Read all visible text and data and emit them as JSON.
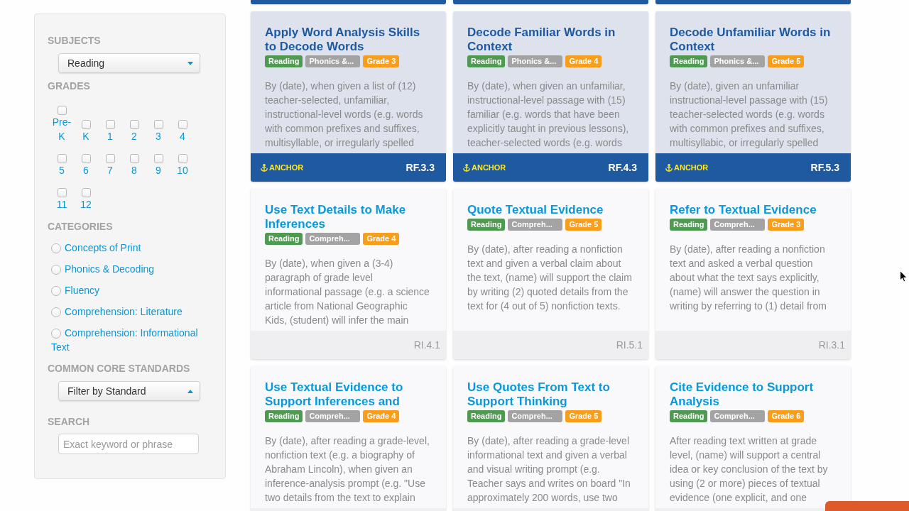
{
  "sidebar": {
    "subjects": {
      "heading": "SUBJECTS",
      "select": {
        "value": "Reading",
        "expanded": false
      }
    },
    "grades": {
      "heading": "GRADES",
      "items": [
        {
          "label": "Pre-K",
          "checked": false
        },
        {
          "label": "K",
          "checked": false
        },
        {
          "label": "1",
          "checked": false
        },
        {
          "label": "2",
          "checked": false
        },
        {
          "label": "3",
          "checked": false
        },
        {
          "label": "4",
          "checked": false
        },
        {
          "label": "5",
          "checked": false
        },
        {
          "label": "6",
          "checked": false
        },
        {
          "label": "7",
          "checked": false
        },
        {
          "label": "8",
          "checked": false
        },
        {
          "label": "9",
          "checked": false
        },
        {
          "label": "10",
          "checked": false
        },
        {
          "label": "11",
          "checked": false
        },
        {
          "label": "12",
          "checked": false
        }
      ]
    },
    "categories": {
      "heading": "CATEGORIES",
      "items": [
        {
          "label": "Concepts of Print",
          "selected": false
        },
        {
          "label": "Phonics & Decoding",
          "selected": false
        },
        {
          "label": "Fluency",
          "selected": false
        },
        {
          "label": "Comprehension: Literature",
          "selected": false
        },
        {
          "label": "Comprehension: Informational Text",
          "selected": false
        }
      ]
    },
    "standards": {
      "heading": "COMMON CORE STANDARDS",
      "select": {
        "value": "Filter by Standard",
        "expanded": true
      }
    },
    "search": {
      "heading": "SEARCH",
      "placeholder": "Exact keyword or phrase"
    }
  },
  "partial_cards": [
    {
      "anchor": true
    },
    {
      "anchor": true
    },
    {
      "anchor": true
    }
  ],
  "cards": [
    {
      "title": "Apply Word Analysis Skills to Decode Words",
      "tags": [
        {
          "label": "Reading",
          "color": "#4e9a50"
        },
        {
          "label": "Phonics &...",
          "color": "#a3a3a3"
        },
        {
          "label": "Grade 3",
          "color": "#f89e1b"
        }
      ],
      "description": "By (date), when given a list of (12) teacher-selected, unfamiliar, instructional-level words (e.g. words with common prefixes and suffixes, multisyllable, or irregularly spelled",
      "anchor": true,
      "anchor_label": "ANCHOR",
      "code": "RF.3.3"
    },
    {
      "title": "Decode Familiar Words in Context",
      "tags": [
        {
          "label": "Reading",
          "color": "#4e9a50"
        },
        {
          "label": "Phonics &...",
          "color": "#a3a3a3"
        },
        {
          "label": "Grade 4",
          "color": "#f89e1b"
        }
      ],
      "description": "By (date), when given an unfamiliar, instructional-level passage with (15) familiar (e.g. words that have been explicitly taught in previous lessons), teacher-selected words (e.g. words",
      "anchor": true,
      "anchor_label": "ANCHOR",
      "code": "RF.4.3"
    },
    {
      "title": "Decode Unfamiliar Words in Context",
      "tags": [
        {
          "label": "Reading",
          "color": "#4e9a50"
        },
        {
          "label": "Phonics &...",
          "color": "#a3a3a3"
        },
        {
          "label": "Grade 5",
          "color": "#f89e1b"
        }
      ],
      "description": "By (date), given an unfamiliar instructional-level passage with (15) teacher-selected words (e.g. words with common prefixes and suffixes, multisyllabic, or irregularly spelled",
      "anchor": true,
      "anchor_label": "ANCHOR",
      "code": "RF.5.3"
    },
    {
      "title": "Use Text Details to Make Inferences",
      "tags": [
        {
          "label": "Reading",
          "color": "#4e9a50"
        },
        {
          "label": "Compreh...",
          "color": "#a3a3a3"
        },
        {
          "label": "Grade 4",
          "color": "#f89e1b"
        }
      ],
      "description": "By (date), when given a (3-4) paragraph of grade level informational passage (e.g. a science article from National Geographic Kids, (student) will infer the main",
      "anchor": false,
      "code": "RI.4.1"
    },
    {
      "title": "Quote Textual Evidence",
      "tags": [
        {
          "label": "Reading",
          "color": "#4e9a50"
        },
        {
          "label": "Compreh...",
          "color": "#a3a3a3"
        },
        {
          "label": "Grade 5",
          "color": "#f89e1b"
        }
      ],
      "description": "By (date), after reading a nonfiction text and given a verbal claim about the text, (name) will support the claim by writing (2) quoted details from the text for (4 out of 5) nonfiction texts.",
      "anchor": false,
      "code": "RI.5.1"
    },
    {
      "title": "Refer to Textual Evidence",
      "tags": [
        {
          "label": "Reading",
          "color": "#4e9a50"
        },
        {
          "label": "Compreh...",
          "color": "#a3a3a3"
        },
        {
          "label": "Grade 3",
          "color": "#f89e1b"
        }
      ],
      "description": "By (date), after reading a nonfiction text and asked a verbal question about what the text says explicitly, (name) will answer the question in writing by referring to (1) detail from",
      "anchor": false,
      "code": "RI.3.1"
    },
    {
      "title": "Use Textual Evidence to Support Inferences and",
      "tags": [
        {
          "label": "Reading",
          "color": "#4e9a50"
        },
        {
          "label": "Compreh...",
          "color": "#a3a3a3"
        },
        {
          "label": "Grade 4",
          "color": "#f89e1b"
        }
      ],
      "description": "By (date), after reading a grade-level, nonfiction text (e.g. a biography of Abraham Lincoln), when given an inference-analysis prompt (e.g. \"Use two details from the text to explain",
      "anchor": false
    },
    {
      "title": "Use Quotes From Text to Support Thinking",
      "tags": [
        {
          "label": "Reading",
          "color": "#4e9a50"
        },
        {
          "label": "Compreh...",
          "color": "#a3a3a3"
        },
        {
          "label": "Grade 5",
          "color": "#f89e1b"
        }
      ],
      "description": "By (date), after reading a grade-level informational text and given a verbal and visual writing prompt (e.g. Teacher says and writes on board \"In approximately 200 words, use two",
      "anchor": false
    },
    {
      "title": "Cite Evidence to Support Analysis",
      "tags": [
        {
          "label": "Reading",
          "color": "#4e9a50"
        },
        {
          "label": "Compreh...",
          "color": "#a3a3a3"
        },
        {
          "label": "Grade 6",
          "color": "#f89e1b"
        }
      ],
      "description": "After reading text written at grade level, (name) will support a central idea or key conclusion of the text by using (2 or more) pieces of textual evidence (one explicit, and one",
      "anchor": false
    }
  ]
}
